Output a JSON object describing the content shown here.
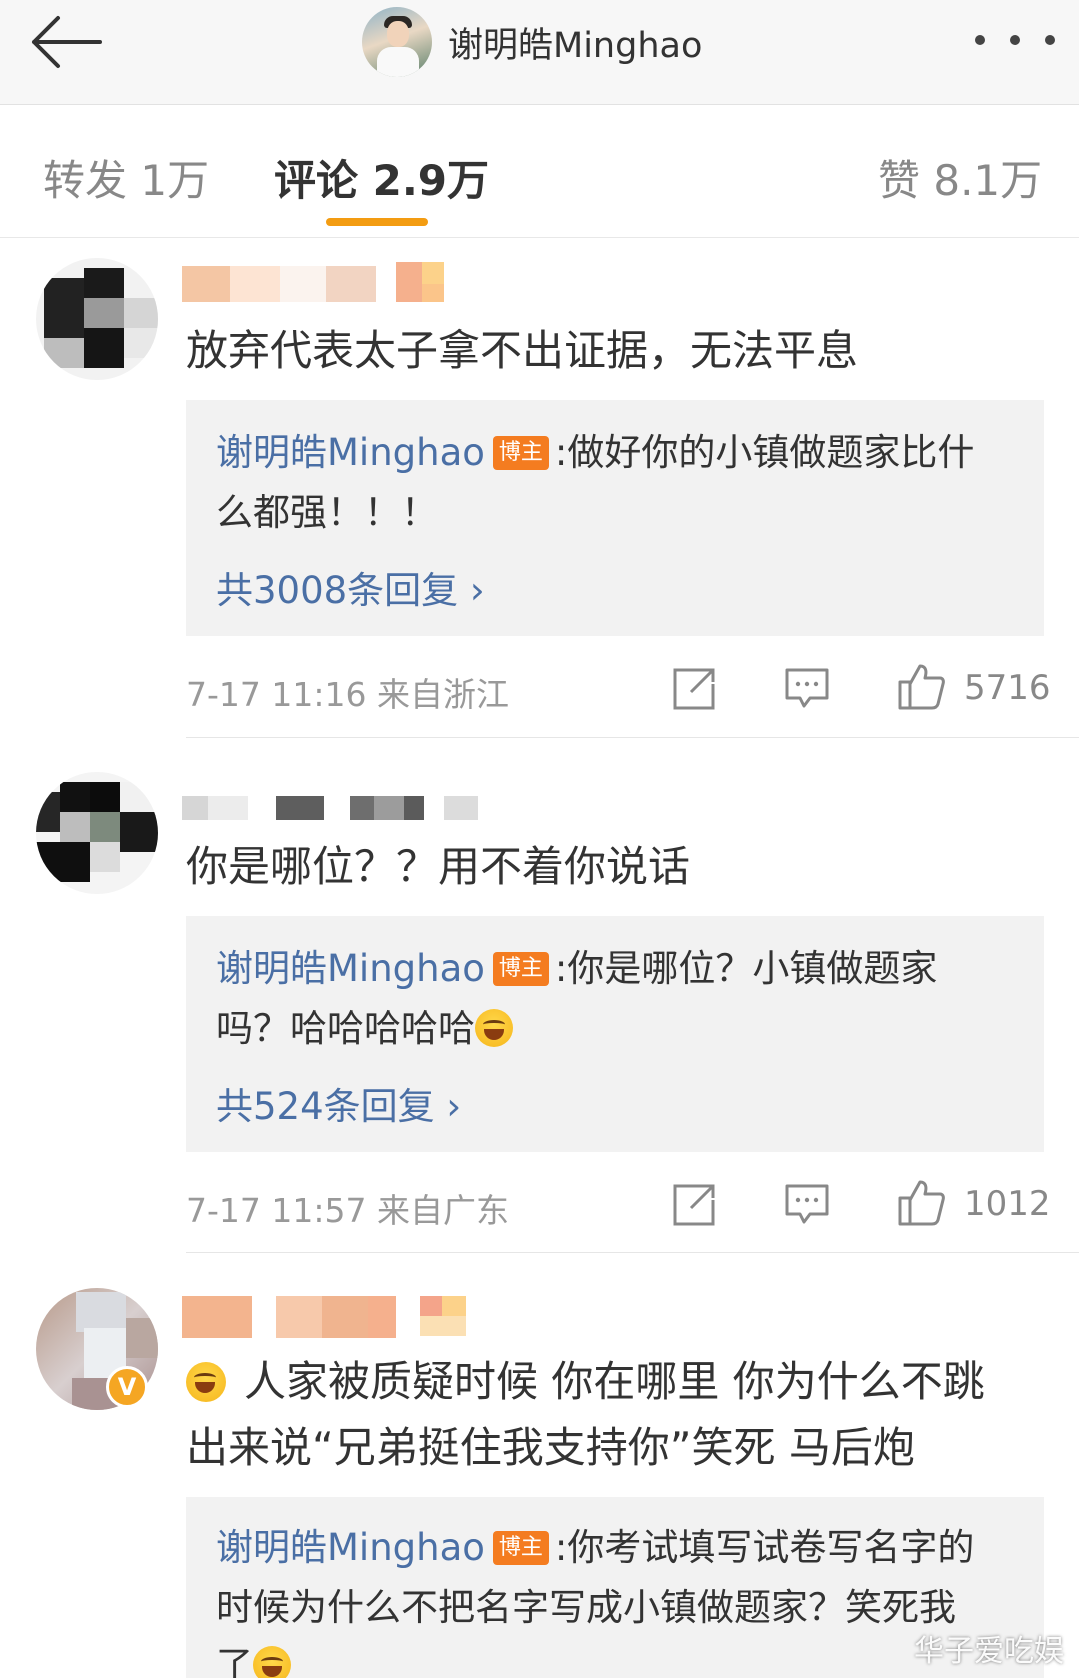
{
  "header": {
    "back_icon": "back-arrow-icon",
    "title": "谢明皓Minghao",
    "more_icon": "more-dots-icon"
  },
  "tabs": [
    {
      "label": "转发 1万"
    },
    {
      "label": "评论 2.9万",
      "active": true
    },
    {
      "label": "赞 8.1万"
    }
  ],
  "comments": [
    {
      "text": "放弃代表太子拿不出证据，无法平息",
      "reply": {
        "author": "谢明皓Minghao",
        "badge": "博主",
        "line1": ":做好你的小镇做题家比什",
        "line2": "么都强！！！",
        "count": "共3008条回复 ›"
      },
      "time": "7-17 11:16  来自浙江",
      "likes": "5716"
    },
    {
      "text": "你是哪位？？用不着你说话",
      "reply": {
        "author": "谢明皓Minghao",
        "badge": "博主",
        "line1": ":你是哪位？小镇做题家",
        "line2": "吗？哈哈哈哈哈",
        "count": "共524条回复 ›"
      },
      "time": "7-17 11:57  来自广东",
      "likes": "1012"
    },
    {
      "text1": "人家被质疑时候 你在哪里 你为什么不跳",
      "text2": "出来说“兄弟挺住我支持你”笑死 马后炮",
      "verified": "V",
      "reply": {
        "author": "谢明皓Minghao",
        "badge": "博主",
        "line1": ":你考试填写试卷写名字的",
        "line2": "时候为什么不把名字写成小镇做题家？笑死我",
        "line3": "了"
      }
    }
  ],
  "watermark": "华子爱吃娱",
  "colors": {
    "accent": "#f39c12",
    "link": "#4a6fa5",
    "badge": "#f47c20"
  }
}
